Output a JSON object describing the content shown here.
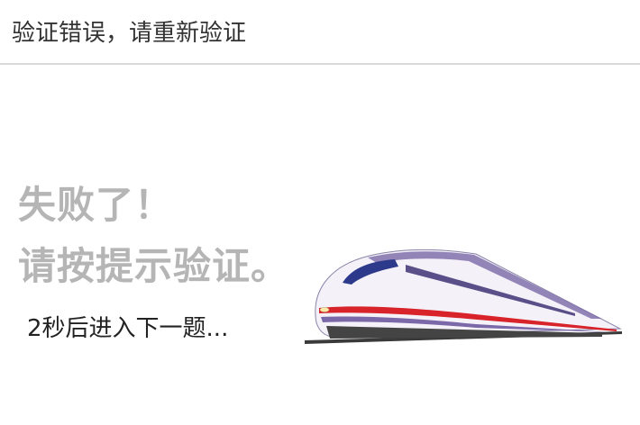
{
  "header": {
    "title": "验证错误，请重新验证"
  },
  "result": {
    "fail_line_1": "失败了！",
    "fail_line_2": "请按提示验证。",
    "countdown": "2秒后进入下一题..."
  },
  "illustration": {
    "icon": "high-speed-train",
    "colors": {
      "body": "#f4f2f8",
      "stripe_red": "#d8232a",
      "stripe_purple": "#7b68a8",
      "window": "#2d3a8c",
      "track": "#333333"
    }
  }
}
